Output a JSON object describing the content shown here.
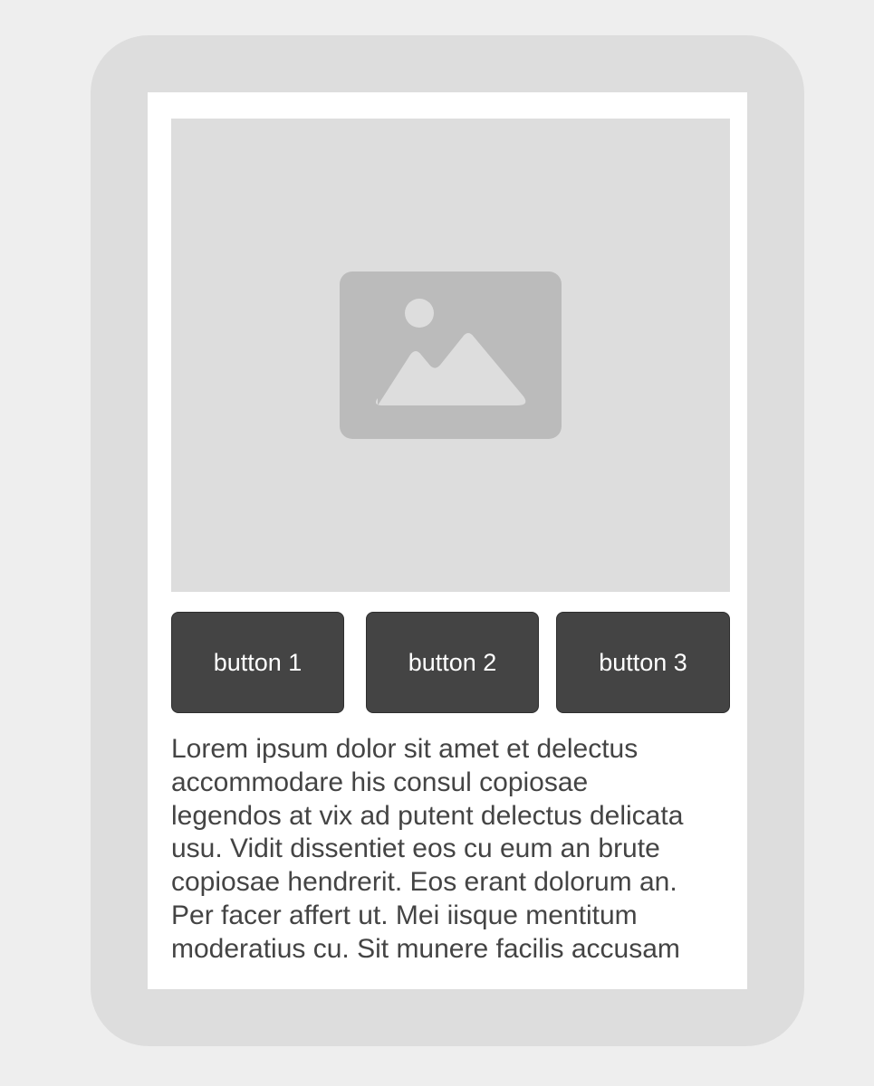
{
  "buttons": [
    {
      "label": "button 1"
    },
    {
      "label": "button 2"
    },
    {
      "label": "button 3"
    }
  ],
  "content": {
    "image_icon": "image-placeholder-icon",
    "paragraph": "Lorem ipsum dolor sit amet et delectus\naccommodare his consul copiosae\nlegendos at vix ad putent delectus delicata\nusu. Vidit dissentiet eos cu eum an brute\ncopiosae hendrerit. Eos erant dolorum an.\nPer facer affert ut. Mei iisque mentitum\nmoderatius cu. Sit munere facilis accusam"
  },
  "colors": {
    "page_background": "#eeeeee",
    "device_frame": "#dddddd",
    "screen": "#ffffff",
    "button": "#444444",
    "button_text": "#ffffff",
    "body_text": "#444444",
    "placeholder": "#dddddd",
    "placeholder_icon": "#bbbbbb"
  }
}
